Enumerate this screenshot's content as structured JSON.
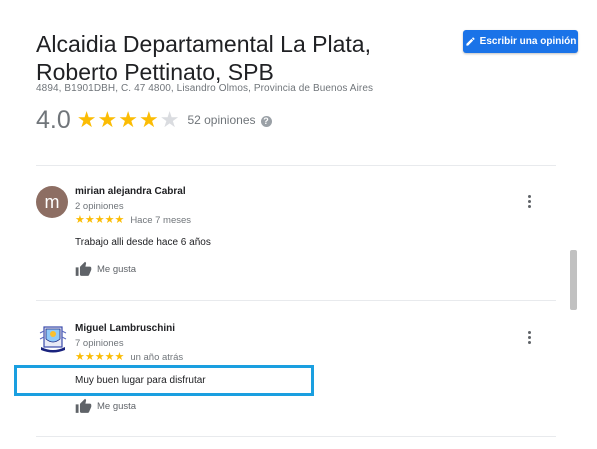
{
  "place": {
    "title": "Alcaidia Departamental La Plata, Roberto Pettinato, SPB",
    "address": "4894, B1901DBH, C. 47 4800, Lisandro Olmos, Provincia de Buenos Aires",
    "rating": "4.0",
    "rating_value": 4.0,
    "review_count": "52 opiniones",
    "info_icon": "?"
  },
  "actions": {
    "write_review": "Escribir una opinión"
  },
  "reviews": [
    {
      "avatar_letter": "m",
      "name": "mirian alejandra Cabral",
      "count": "2 opiniones",
      "stars": "★★★★★",
      "date": "Hace 7 meses",
      "text": "Trabajo alli desde hace 6 años",
      "like": "Me gusta"
    },
    {
      "name": "Miguel Lambruschini",
      "count": "7 opiniones",
      "stars": "★★★★★",
      "date": "un año atrás",
      "text": "Muy buen lugar para disfrutar",
      "like": "Me gusta"
    }
  ],
  "colors": {
    "accent": "#1a73e8",
    "star": "#fbbc04",
    "highlight": "#1a9fe0",
    "avatar": "#8d6e63"
  }
}
